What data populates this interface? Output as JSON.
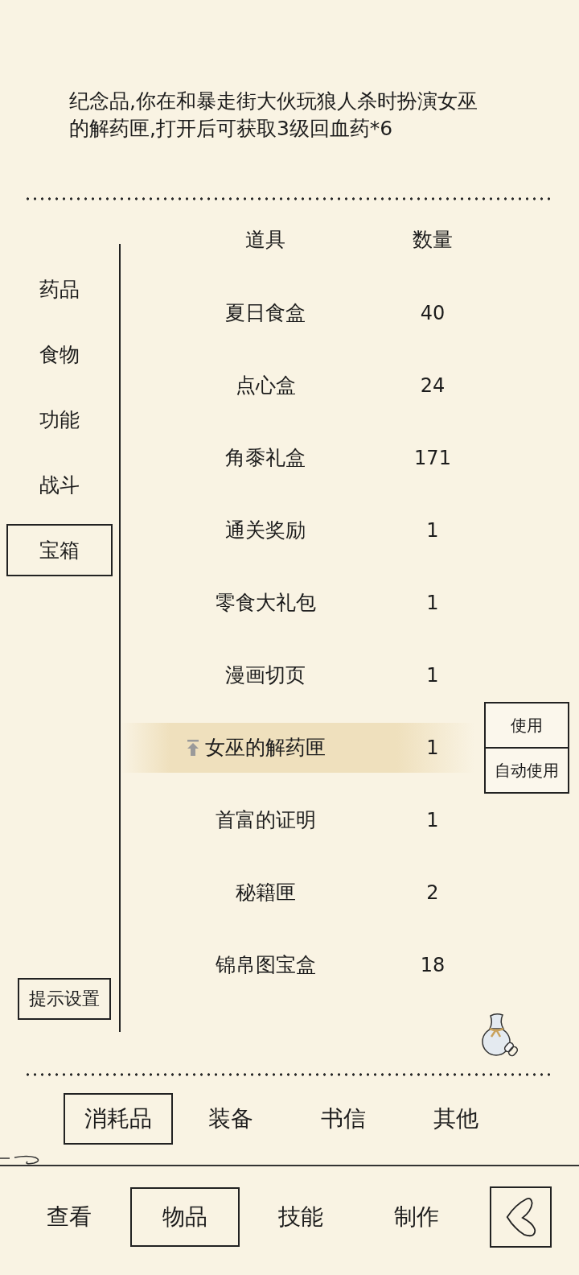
{
  "description": "纪念品,你在和暴走街大伙玩狼人杀时扮演女巫的解药匣,打开后可获取3级回血药*6",
  "sidebar": {
    "items": [
      {
        "label": "药品",
        "selected": false
      },
      {
        "label": "食物",
        "selected": false
      },
      {
        "label": "功能",
        "selected": false
      },
      {
        "label": "战斗",
        "selected": false
      },
      {
        "label": "宝箱",
        "selected": true
      }
    ],
    "settings_button": "提示设置"
  },
  "table": {
    "columns": [
      "道具",
      "数量"
    ],
    "rows": [
      {
        "name": "夏日食盒",
        "count": "40",
        "selected": false
      },
      {
        "name": "点心盒",
        "count": "24",
        "selected": false
      },
      {
        "name": "角黍礼盒",
        "count": "171",
        "selected": false
      },
      {
        "name": "通关奖励",
        "count": "1",
        "selected": false
      },
      {
        "name": "零食大礼包",
        "count": "1",
        "selected": false
      },
      {
        "name": "漫画切页",
        "count": "1",
        "selected": false
      },
      {
        "name": "女巫的解药匣",
        "count": "1",
        "selected": true
      },
      {
        "name": "首富的证明",
        "count": "1",
        "selected": false
      },
      {
        "name": "秘籍匣",
        "count": "2",
        "selected": false
      },
      {
        "name": "锦帛图宝盒",
        "count": "18",
        "selected": false
      }
    ],
    "selected_row_actions": [
      "使用",
      "自动使用"
    ]
  },
  "category_tabs": [
    {
      "label": "消耗品",
      "selected": true
    },
    {
      "label": "装备",
      "selected": false
    },
    {
      "label": "书信",
      "selected": false
    },
    {
      "label": "其他",
      "selected": false
    }
  ],
  "nav_tabs": [
    {
      "label": "查看",
      "selected": false
    },
    {
      "label": "物品",
      "selected": true
    },
    {
      "label": "技能",
      "selected": false
    },
    {
      "label": "制作",
      "selected": false
    }
  ]
}
